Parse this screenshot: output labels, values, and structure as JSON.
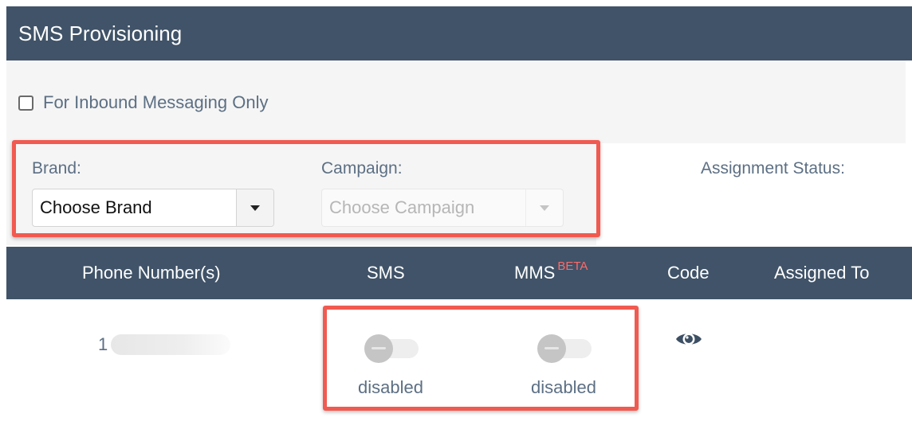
{
  "header": {
    "title": "SMS Provisioning"
  },
  "inbound": {
    "label": "For Inbound Messaging Only",
    "checked": false
  },
  "filters": {
    "brand_label": "Brand:",
    "brand_value": "Choose Brand",
    "campaign_label": "Campaign:",
    "campaign_placeholder": "Choose Campaign",
    "assignment_label": "Assignment Status:"
  },
  "table": {
    "columns": {
      "phone": "Phone Number(s)",
      "sms": "SMS",
      "mms": "MMS",
      "mms_badge": "BETA",
      "code": "Code",
      "assigned": "Assigned To"
    },
    "rows": [
      {
        "phone_visible": "1",
        "sms_status": "disabled",
        "mms_status": "disabled",
        "code_icon": "eye-icon"
      }
    ]
  },
  "colors": {
    "header_bg": "#405368",
    "label_text": "#5c6f84",
    "highlight": "#f15a50",
    "beta": "#ff6a6a"
  }
}
